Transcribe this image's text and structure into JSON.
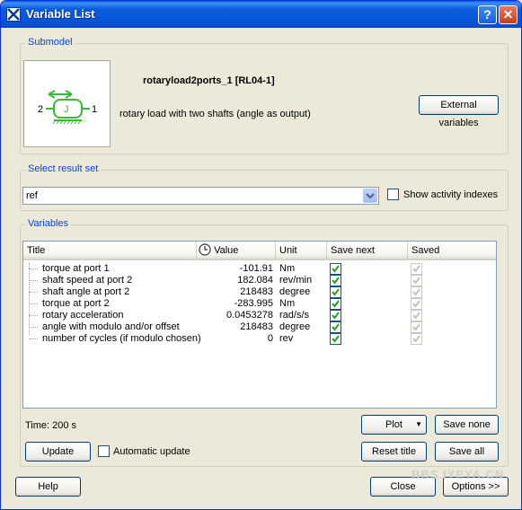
{
  "window": {
    "title": "Variable List",
    "help_glyph": "?",
    "close_glyph": "✕"
  },
  "submodel": {
    "group_label": "Submodel",
    "name": "rotaryload2ports_1 [RL04-1]",
    "description": "rotary load with two shafts (angle as output)",
    "icon_letter": "J",
    "port_left": "2",
    "port_right": "1",
    "external_variables_label": "External variables"
  },
  "result_set": {
    "group_label": "Select result set",
    "value": "ref",
    "show_activity_label": "Show activity indexes"
  },
  "variables": {
    "group_label": "Variables",
    "columns": {
      "title": "Title",
      "value": "Value",
      "unit": "Unit",
      "save_next": "Save next",
      "saved": "Saved"
    },
    "rows": [
      {
        "title": "torque at port 1",
        "value": "-101.91",
        "unit": "Nm",
        "save_next": true,
        "saved": true
      },
      {
        "title": "shaft speed at port 2",
        "value": "182.084",
        "unit": "rev/min",
        "save_next": true,
        "saved": true
      },
      {
        "title": "shaft angle at port 2",
        "value": "218483",
        "unit": "degree",
        "save_next": true,
        "saved": true
      },
      {
        "title": "torque at port 2",
        "value": "-283.995",
        "unit": "Nm",
        "save_next": true,
        "saved": true
      },
      {
        "title": "rotary acceleration",
        "value": "0.0453278",
        "unit": "rad/s/s",
        "save_next": true,
        "saved": true
      },
      {
        "title": "angle with modulo and/or offset",
        "value": "218483",
        "unit": "degree",
        "save_next": true,
        "saved": true
      },
      {
        "title": "number of cycles (if modulo chosen)",
        "value": "0",
        "unit": "rev",
        "save_next": true,
        "saved": true
      }
    ],
    "time_label": "Time: 200 s",
    "plot_label": "Plot",
    "save_none_label": "Save none",
    "update_label": "Update",
    "automatic_update_label": "Automatic update",
    "reset_title_label": "Reset title",
    "save_all_label": "Save all"
  },
  "footer": {
    "help_label": "Help",
    "close_label": "Close",
    "options_label": "Options >>"
  },
  "watermark": "BBS.IYEYA.CN",
  "colors": {
    "titlebar": "#0553d4",
    "group_label": "#0046d5",
    "check_green": "#21a121",
    "check_disabled": "#c4c2b6",
    "icon_green": "#3ab83a"
  }
}
